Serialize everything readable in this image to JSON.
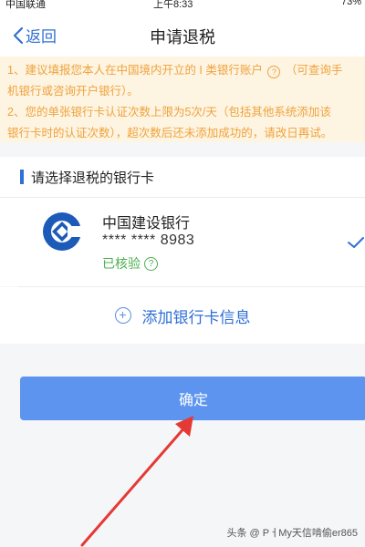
{
  "status_bar": {
    "carrier": "中国联通",
    "time": "上午8:33",
    "battery": "73%"
  },
  "nav": {
    "back_label": "返回",
    "title": "申请退税"
  },
  "notice": {
    "line1_a": "1、建议填报您本人在中国境内开立的 I 类银行账户",
    "line1_b": "（可查询手",
    "line2": "机银行或咨询开户银行）。",
    "line3": "2、您的单张银行卡认证次数上限为5次/天（包括其他系统添加该",
    "line4": "银行卡时的认证次数），超次数后还未添加成功的，请改日再试。",
    "help_glyph": "?"
  },
  "section": {
    "title": "请选择退税的银行卡"
  },
  "card": {
    "bank_name": "中国建设银行",
    "number": "**** **** 8983",
    "status": "已核验",
    "status_help_glyph": "?",
    "selected": true
  },
  "add_card": {
    "label": "添加银行卡信息"
  },
  "confirm_button": {
    "label": "确定"
  },
  "watermark": "头条 @ PㅓMy天信啃偷er865",
  "colors": {
    "accent": "#2f6fd6",
    "notice_text": "#f0a23c",
    "notice_bg": "#fdf4e2",
    "verified": "#4caf50",
    "button": "#5c94ef",
    "annotation_arrow": "#e53935"
  },
  "icons": [
    "back-chevron-icon",
    "help-icon",
    "ccb-bank-logo",
    "checkmark-icon",
    "add-circle-icon",
    "annotation-arrow"
  ]
}
